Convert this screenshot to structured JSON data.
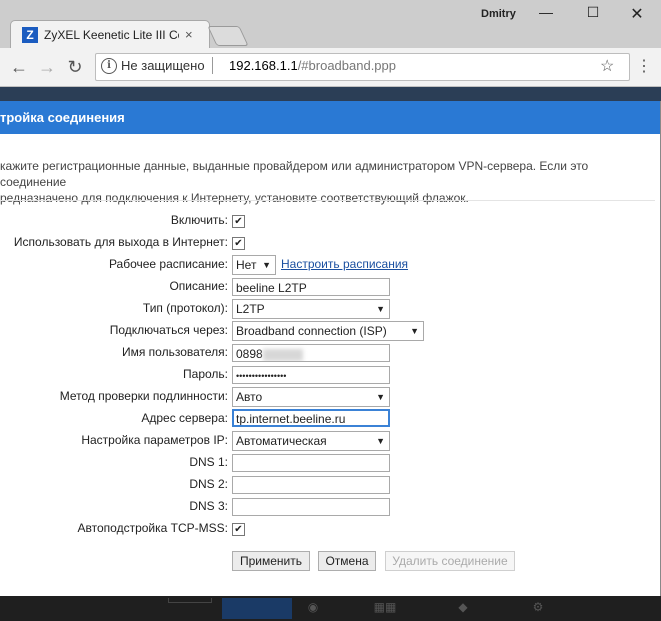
{
  "browser": {
    "tab_title": "ZyXEL Keenetic Lite III Co",
    "tab_favicon": "Z",
    "tab_close": "×",
    "user": "Dmitry",
    "security_label": "Не защищено",
    "url_host": "192.168.1.1",
    "url_path": "/#broadband.ppp",
    "icons": [
      "back-arrow-icon",
      "forward-arrow-icon",
      "reload-icon",
      "info-icon",
      "star-icon",
      "menu-dots-icon"
    ]
  },
  "dialog": {
    "title": "тройка соединения",
    "intro_line1": "кажите регистрационные данные, выданные провайдером или администратором VPN-сервера. Если это соединение",
    "intro_line2": "редназначено для подключения к Интернету, установите соответствующий флажок."
  },
  "form": {
    "enable_label": "Включить:",
    "enable_checked": true,
    "internet_label": "Использовать для выхода в Интернет:",
    "internet_checked": true,
    "schedule_label": "Рабочее расписание:",
    "schedule_value": "Нет",
    "schedule_link": "Настроить расписания",
    "description_label": "Описание:",
    "description_value": "beeline L2TP",
    "type_label": "Тип (протокол):",
    "type_value": "L2TP",
    "via_label": "Подключаться через:",
    "via_value": "Broadband connection (ISP)",
    "username_label": "Имя пользователя:",
    "username_value": "0898",
    "password_label": "Пароль:",
    "password_value": "••••••••••••••••",
    "auth_label": "Метод проверки подлинности:",
    "auth_value": "Авто",
    "server_label": "Адрес сервера:",
    "server_value": "tp.internet.beeline.ru",
    "ip_label": "Настройка параметров IP:",
    "ip_value": "Автоматическая",
    "dns1_label": "DNS 1:",
    "dns1_value": "",
    "dns2_label": "DNS 2:",
    "dns2_value": "",
    "dns3_label": "DNS 3:",
    "dns3_value": "",
    "tcpmss_label": "Автоподстройка TCP-MSS:",
    "tcpmss_checked": true
  },
  "buttons": {
    "apply": "Применить",
    "cancel": "Отмена",
    "delete": "Удалить соединение"
  },
  "colors": {
    "header_blue": "#2a79d4",
    "link_blue": "#1a4fa0"
  }
}
